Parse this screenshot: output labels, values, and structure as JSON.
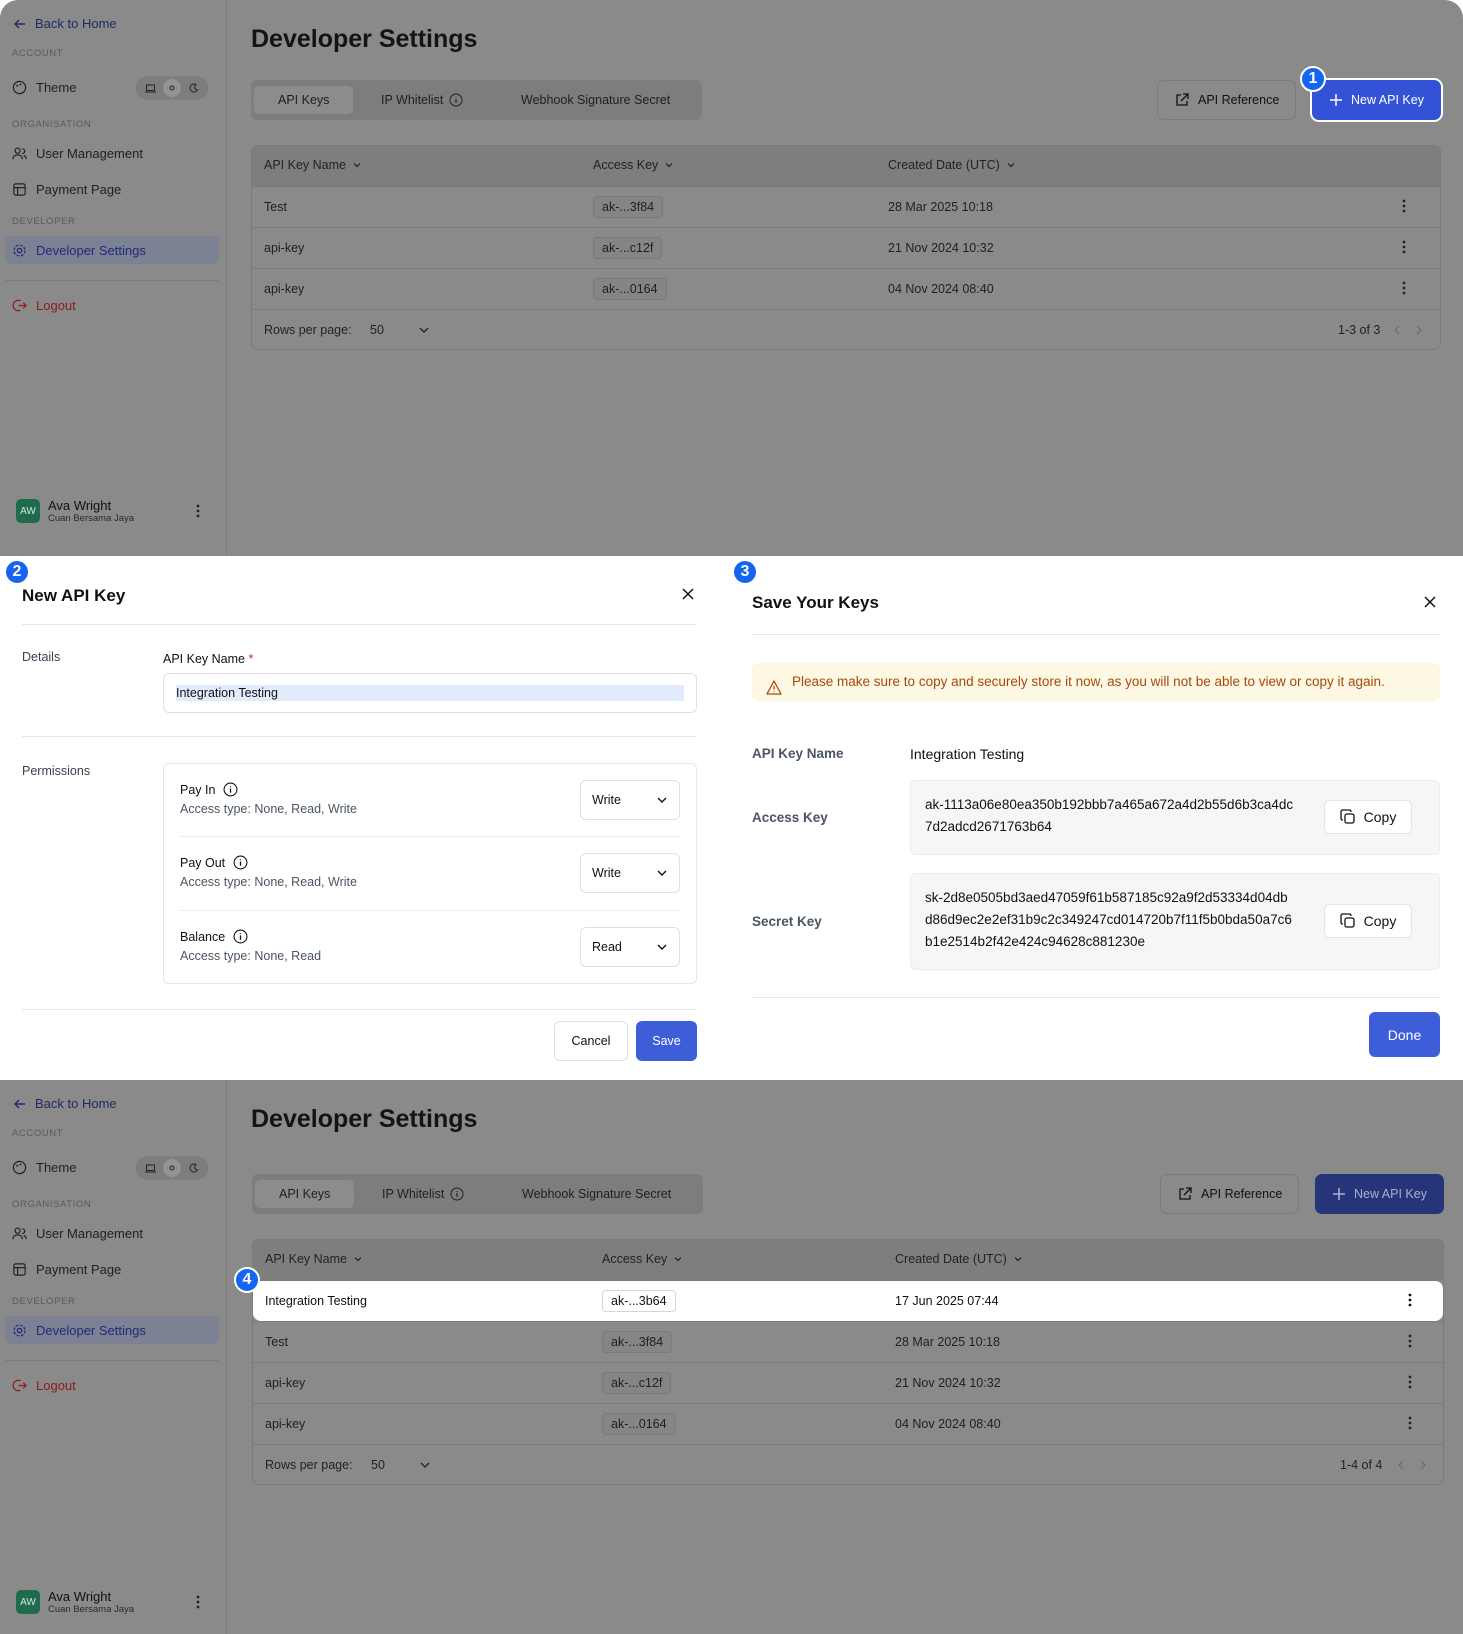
{
  "sidebar": {
    "back": "Back to Home",
    "sec_account": "ACCOUNT",
    "theme": "Theme",
    "sec_org": "ORGANISATION",
    "user_mgmt": "User Management",
    "payment": "Payment Page",
    "sec_dev": "DEVELOPER",
    "dev_settings": "Developer Settings",
    "logout": "Logout",
    "user_initials": "AW",
    "user_name": "Ava Wright",
    "user_org": "Cuan Bersama Jaya"
  },
  "page": {
    "title": "Developer Settings",
    "tabs": [
      "API Keys",
      "IP Whitelist",
      "Webhook Signature Secret"
    ],
    "api_reference": "API Reference",
    "new_api_key": "New API Key"
  },
  "table": {
    "headers": [
      "API Key Name",
      "Access Key",
      "Created Date (UTC)"
    ],
    "rows_before": [
      {
        "name": "Test",
        "key": "ak-...3f84",
        "date": "28 Mar 2025 10:18"
      },
      {
        "name": "api-key",
        "key": "ak-...c12f",
        "date": "21 Nov 2024 10:32"
      },
      {
        "name": "api-key",
        "key": "ak-...0164",
        "date": "04 Nov 2024 08:40"
      }
    ],
    "rows_after": [
      {
        "name": "Integration Testing",
        "key": "ak-...3b64",
        "date": "17 Jun 2025 07:44"
      },
      {
        "name": "Test",
        "key": "ak-...3f84",
        "date": "28 Mar 2025 10:18"
      },
      {
        "name": "api-key",
        "key": "ak-...c12f",
        "date": "21 Nov 2024 10:32"
      },
      {
        "name": "api-key",
        "key": "ak-...0164",
        "date": "04 Nov 2024 08:40"
      }
    ],
    "rows_per_page_label": "Rows per page:",
    "rows_per_page": "50",
    "pagination_before": "1-3 of 3",
    "pagination_after": "1-4 of 4"
  },
  "steps": [
    "1",
    "2",
    "3",
    "4"
  ],
  "new_modal": {
    "title": "New API Key",
    "details": "Details",
    "name_label": "API Key Name",
    "required": "*",
    "name_value": "Integration Testing",
    "permissions": "Permissions",
    "perms": [
      {
        "name": "Pay In",
        "desc": "Access type: None, Read, Write",
        "value": "Write"
      },
      {
        "name": "Pay Out",
        "desc": "Access type: None, Read, Write",
        "value": "Write"
      },
      {
        "name": "Balance",
        "desc": "Access type: None, Read",
        "value": "Read"
      }
    ],
    "cancel": "Cancel",
    "save": "Save"
  },
  "save_modal": {
    "title": "Save Your Keys",
    "warning": "Please make sure to copy and securely store it now, as you will not be able to view or copy it again.",
    "name_label": "API Key Name",
    "name_value": "Integration Testing",
    "access_label": "Access Key",
    "access_value": "ak-1113a06e80ea350b192bbb7a465a672a4d2b55d6b3ca4dc7d2adcd2671763b64",
    "secret_label": "Secret Key",
    "secret_value": "sk-2d8e0505bd3aed47059f61b587185c92a9f2d53334d04dbd86d9ec2e2ef31b9c2c349247cd014720b7f11f5b0bda50a7c6b1e2514b2f42e424c94628c881230e",
    "copy": "Copy",
    "done": "Done"
  },
  "colors": {
    "primary": "#3d5ed8",
    "badge": "#1565f0",
    "warning_bg": "#fdf8e4",
    "warning_text": "#a64a0a"
  }
}
